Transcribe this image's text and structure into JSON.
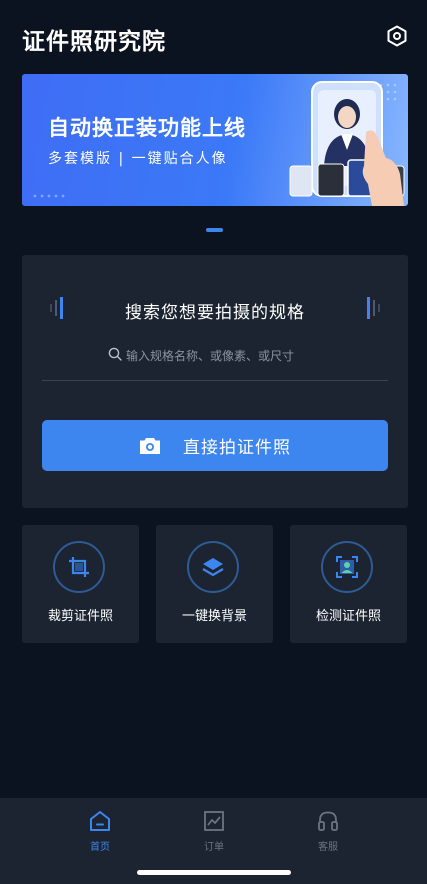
{
  "app": {
    "title": "证件照研究院"
  },
  "header": {
    "settings_icon": "hexagon-settings-icon"
  },
  "banner": {
    "title": "自动换正装功能上线",
    "subtitle": "多套模版 | 一键贴合人像"
  },
  "carousel": {
    "active_index": 0
  },
  "search": {
    "heading": "搜索您想要拍摄的规格",
    "placeholder": "输入规格名称、或像素、或尺寸",
    "value": ""
  },
  "capture": {
    "label": "直接拍证件照",
    "icon": "camera-icon"
  },
  "tools": [
    {
      "label": "裁剪证件照",
      "icon": "crop-icon"
    },
    {
      "label": "一键换背景",
      "icon": "layers-icon"
    },
    {
      "label": "检测证件照",
      "icon": "face-scan-icon"
    }
  ],
  "nav": {
    "items": [
      {
        "label": "首页",
        "icon": "home-icon",
        "active": true
      },
      {
        "label": "订单",
        "icon": "chart-icon",
        "active": false
      },
      {
        "label": "客服",
        "icon": "headset-icon",
        "active": false
      }
    ]
  },
  "colors": {
    "background": "#0b1320",
    "card": "#1c2431",
    "accent": "#3d86ef",
    "muted": "#6b7482"
  }
}
